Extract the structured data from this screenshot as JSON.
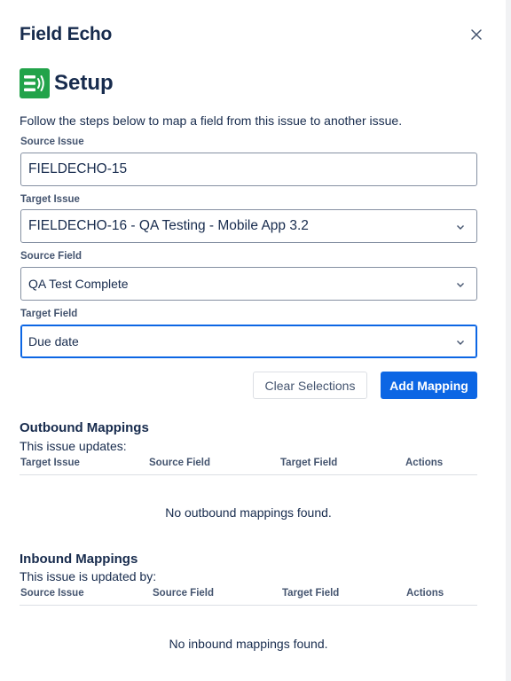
{
  "app": {
    "title": "Field Echo"
  },
  "header": {
    "title": "Setup",
    "logo_icon": "field-echo-logo",
    "close_icon": "close-icon"
  },
  "intro": "Follow the steps below to map a field from this issue to another issue.",
  "form": {
    "source_issue": {
      "label": "Source Issue",
      "value": "FIELDECHO-15"
    },
    "target_issue": {
      "label": "Target Issue",
      "value": "FIELDECHO-16 - QA Testing - Mobile App 3.2"
    },
    "source_field": {
      "label": "Source Field",
      "value": "QA Test Complete"
    },
    "target_field": {
      "label": "Target Field",
      "value": "Due date"
    }
  },
  "buttons": {
    "clear": "Clear Selections",
    "add": "Add Mapping"
  },
  "outbound": {
    "title": "Outbound Mappings",
    "subtitle": "This issue updates:",
    "columns": [
      "Target Issue",
      "Source Field",
      "Target Field",
      "Actions"
    ],
    "empty": "No outbound mappings found."
  },
  "inbound": {
    "title": "Inbound Mappings",
    "subtitle": "This issue is updated by:",
    "columns": [
      "Source Issue",
      "Source Field",
      "Target Field",
      "Actions"
    ],
    "empty": "No inbound mappings found."
  },
  "colors": {
    "primary": "#0c66e4",
    "logo_green": "#22a34a",
    "text": "#172b4d",
    "subtle": "#44546f",
    "border": "#8590a2"
  }
}
